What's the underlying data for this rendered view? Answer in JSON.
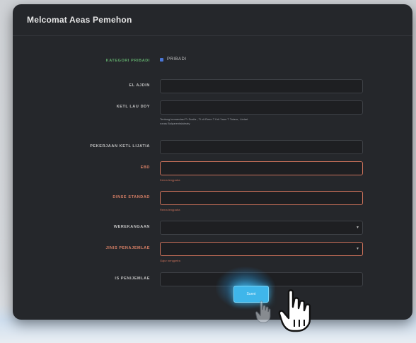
{
  "window": {
    "title": "Melcomat Aeas Pemehon"
  },
  "form": {
    "kategori": {
      "label": "KATEGORI PRIBADI",
      "option": "PRIBADI",
      "selected": true
    },
    "nama": {
      "label": "EL AJDIN",
      "value": ""
    },
    "ttl": {
      "label": "KETL LAU DDY",
      "value": "",
      "hint_line1": "Tentang kemandasi Tr Susila  ,   Tl cit Reen   T Krit Yaon   T Totara  ,  Lintart",
      "hint_line2": "ronas     Bolparentalabraty"
    },
    "pekerjaan": {
      "label": "PEKERJAAN KETL LIJATIA",
      "value": ""
    },
    "email": {
      "label": "EBD",
      "value": "",
      "error": "Kerna lengpatra"
    },
    "nomor": {
      "label": "DINSE STANDAD",
      "value": "",
      "error": "Rema lengpatra"
    },
    "kewarganegaraan": {
      "label": "WEREKANGAAN",
      "value": ""
    },
    "jenis": {
      "label": "JINIS PENAJEMLAE",
      "value": "",
      "error": "Gajur nengpetra"
    },
    "keterangan": {
      "label": "IS PENIJEMLAE",
      "value": ""
    }
  },
  "submit": {
    "label": "Sunnt"
  }
}
